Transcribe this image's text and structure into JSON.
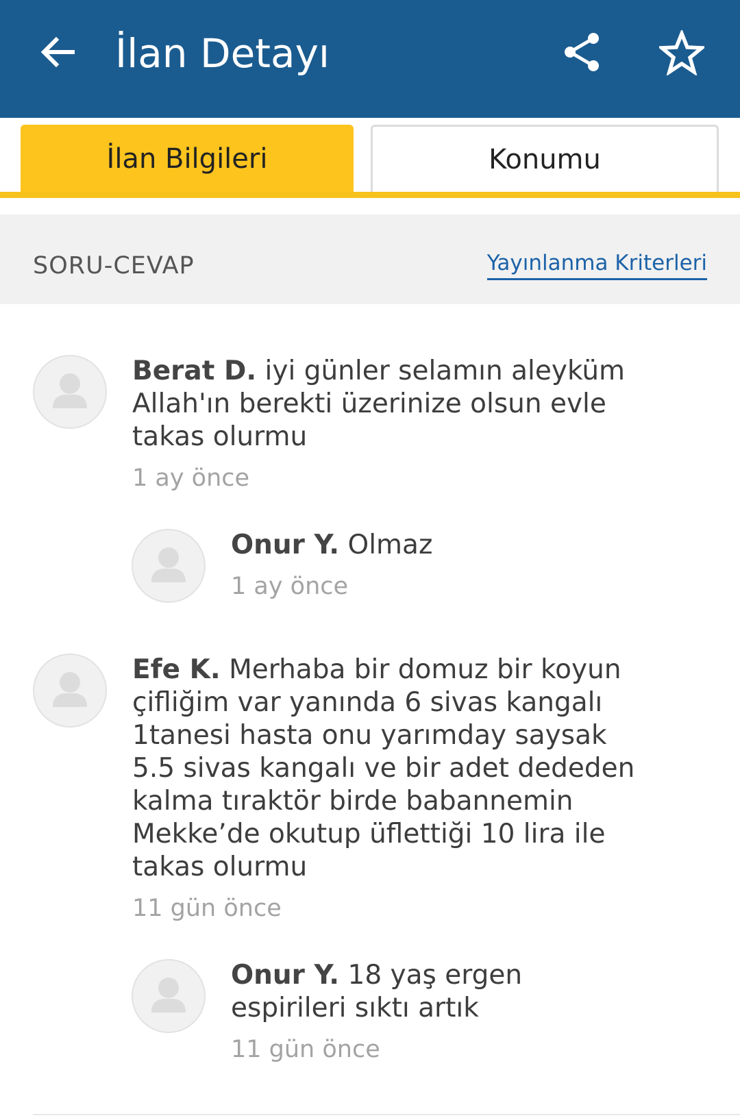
{
  "appbar": {
    "title": "İlan Detayı",
    "back_icon": "arrow-left-icon",
    "share_icon": "share-icon",
    "favorite_icon": "star-outline-icon",
    "color": "#1b5c90"
  },
  "tabs": [
    {
      "label": "İlan Bilgileri",
      "active": true
    },
    {
      "label": "Konumu",
      "active": false
    }
  ],
  "section": {
    "title": "SORU-CEVAP",
    "link": "Yayınlanma Kriterleri"
  },
  "qa": [
    {
      "question": {
        "author": "Berat D.",
        "text": "iyi günler selamın aleyküm Allah'ın berekti üzerinize olsun evle takas olurmu",
        "time": "1 ay önce"
      },
      "answer": {
        "author": "Onur Y.",
        "text": "Olmaz",
        "time": "1 ay önce"
      }
    },
    {
      "question": {
        "author": "Efe K.",
        "text": "Merhaba bir domuz bir koyun çifliğim var yanında 6 sivas kangalı 1tanesi hasta onu yarımday saysak 5.5 sivas kangalı ve bir adet dededen kalma tıraktör birde babannemin Mekke’de okutup üflettiği 10 lira ile takas olurmu",
        "time": "11 gün önce"
      },
      "answer": {
        "author": "Onur Y.",
        "text": "18 yaş ergen espirileri sıktı artık",
        "time": "11 gün önce"
      }
    }
  ],
  "colors": {
    "accent_yellow": "#fcc41d",
    "link_blue": "#1c62a8"
  }
}
